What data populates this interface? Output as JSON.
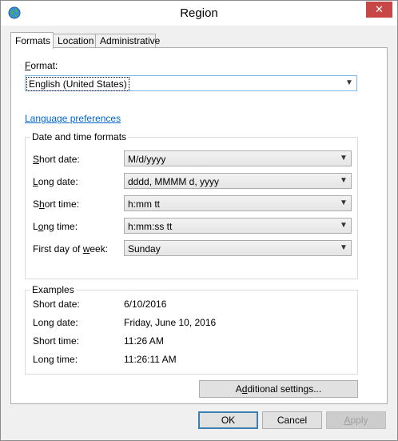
{
  "window": {
    "title": "Region"
  },
  "tabs": [
    {
      "label": "Formats",
      "active": true
    },
    {
      "label": "Location",
      "active": false
    },
    {
      "label": "Administrative",
      "active": false
    }
  ],
  "format": {
    "label_prefix": "F",
    "label_rest": "ormat:",
    "value": "English (United States)"
  },
  "language_link": "Language preferences",
  "date_time": {
    "legend": "Date and time formats",
    "rows": [
      {
        "label_pre": "",
        "label_u": "S",
        "label_post": "hort date:",
        "value": "M/d/yyyy"
      },
      {
        "label_pre": "",
        "label_u": "L",
        "label_post": "ong date:",
        "value": "dddd, MMMM d, yyyy"
      },
      {
        "label_pre": "S",
        "label_u": "h",
        "label_post": "ort time:",
        "value": "h:mm tt"
      },
      {
        "label_pre": "L",
        "label_u": "o",
        "label_post": "ng time:",
        "value": "h:mm:ss tt"
      },
      {
        "label_pre": "First day of ",
        "label_u": "w",
        "label_post": "eek:",
        "value": "Sunday"
      }
    ]
  },
  "examples": {
    "legend": "Examples",
    "rows": [
      {
        "label": "Short date:",
        "value": "6/10/2016"
      },
      {
        "label": "Long date:",
        "value": "Friday, June 10, 2016"
      },
      {
        "label": "Short time:",
        "value": "11:26 AM"
      },
      {
        "label": "Long time:",
        "value": "11:26:11 AM"
      }
    ]
  },
  "additional_settings": {
    "pre": "A",
    "u": "d",
    "post": "ditional settings..."
  },
  "footer": {
    "ok": "OK",
    "cancel": "Cancel",
    "apply_u": "A",
    "apply_post": "pply"
  },
  "colors": {
    "close": "#c74747",
    "link": "#0066cc",
    "default_border": "#3c7fb1"
  }
}
